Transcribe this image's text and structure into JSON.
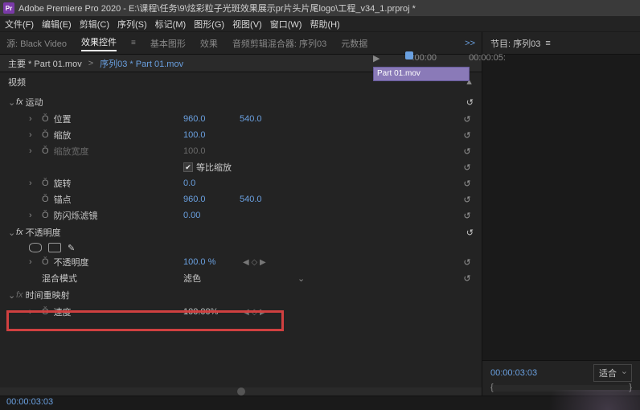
{
  "titlebar": {
    "app_icon": "Pr",
    "title": "Adobe Premiere Pro 2020 - E:\\课程\\任务\\9\\炫彩粒子光斑效果展示pr片头片尾logo\\工程_v34_1.prproj *"
  },
  "menu": {
    "file": "文件(F)",
    "edit": "编辑(E)",
    "clip": "剪辑(C)",
    "sequence": "序列(S)",
    "markers": "标记(M)",
    "graphics": "图形(G)",
    "view": "视图(V)",
    "window": "窗口(W)",
    "help": "帮助(H)"
  },
  "tabs": {
    "source": "源: Black Video",
    "effect_controls": "效果控件",
    "basic_graphics": "基本图形",
    "effects": "效果",
    "audio_mixer": "音频剪辑混合器: 序列03",
    "metadata": "元数据",
    "more": ">>"
  },
  "breadcrumb": {
    "master": "主要 * Part 01.mov",
    "seq": "序列03 * Part 01.mov"
  },
  "mini_timeline": {
    "t0": ":00:00",
    "t1": "00:00:05:",
    "clip": "Part 01.mov"
  },
  "header": {
    "video": "视频"
  },
  "fx": {
    "motion": {
      "title": "运动",
      "position": {
        "label": "位置",
        "x": "960.0",
        "y": "540.0"
      },
      "scale": {
        "label": "缩放",
        "val": "100.0"
      },
      "scale_width": {
        "label": "缩放宽度",
        "val": "100.0"
      },
      "uniform": {
        "label": "等比缩放"
      },
      "rotation": {
        "label": "旋转",
        "val": "0.0"
      },
      "anchor": {
        "label": "锚点",
        "x": "960.0",
        "y": "540.0"
      },
      "antiflicker": {
        "label": "防闪烁滤镜",
        "val": "0.00"
      }
    },
    "opacity": {
      "title": "不透明度",
      "opacity": {
        "label": "不透明度",
        "val": "100.0 %"
      },
      "blend": {
        "label": "混合模式",
        "val": "滤色"
      }
    },
    "timeremap": {
      "title": "时间重映射",
      "speed": {
        "label": "速度",
        "val": "100.00%"
      }
    }
  },
  "right": {
    "panel": "节目: 序列03",
    "timecode": "00:00:03:03",
    "fit": "适合"
  },
  "bottom_tc": "00:00:03:03"
}
